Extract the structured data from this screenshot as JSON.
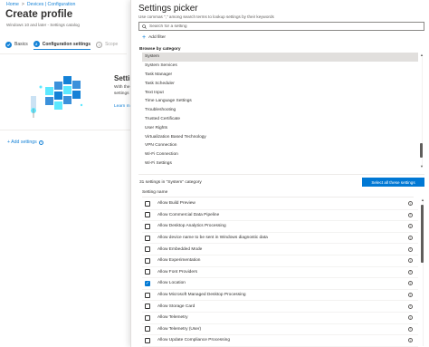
{
  "breadcrumb": [
    "Home",
    "Devices | Configuration"
  ],
  "page": {
    "title": "Create profile",
    "subtitle": "Windows 10 and later - Settings catalog"
  },
  "steps": [
    {
      "number": "1",
      "label": "Basics"
    },
    {
      "number": "2",
      "label": "Configuration settings"
    },
    {
      "number": "3",
      "label": "Scope"
    }
  ],
  "background": {
    "heading": "Settin",
    "text": "With the settings",
    "link": "Learn m",
    "add_settings": "+ Add settings",
    "info_glyph": "i"
  },
  "panel": {
    "title": "Settings picker",
    "description": "Use commas \",\" among search terms to lookup settings by their keywords",
    "search_placeholder": "Search for a setting",
    "add_filter": "Add filter",
    "add_filter_plus": "+",
    "browse_label": "Browse by category",
    "categories": [
      "System",
      "System Services",
      "Task Manager",
      "Task Scheduler",
      "Text Input",
      "Time Language Settings",
      "Troubleshooting",
      "Trusted Certificate",
      "User Rights",
      "Virtualization Based Technology",
      "VPN Connection",
      "Wi-Fi Connection",
      "Wi-Fi Settings"
    ],
    "selected_category": "System",
    "count_label": "31 settings in \"System\" category",
    "select_all_label": "Select all these settings",
    "column_header": "Setting name",
    "settings": [
      {
        "label": "Allow Build Preview",
        "checked": false
      },
      {
        "label": "Allow Commercial Data Pipeline",
        "checked": false
      },
      {
        "label": "Allow Desktop Analytics Processing",
        "checked": false
      },
      {
        "label": "Allow device name to be sent in Windows diagnostic data",
        "checked": false
      },
      {
        "label": "Allow Embedded Mode",
        "checked": false
      },
      {
        "label": "Allow Experimentation",
        "checked": false
      },
      {
        "label": "Allow Font Providers",
        "checked": false
      },
      {
        "label": "Allow Location",
        "checked": true
      },
      {
        "label": "Allow Microsoft Managed Desktop Processing",
        "checked": false
      },
      {
        "label": "Allow Storage Card",
        "checked": false
      },
      {
        "label": "Allow Telemetry",
        "checked": false
      },
      {
        "label": "Allow Telemetry (User)",
        "checked": false
      },
      {
        "label": "Allow Update Compliance Processing",
        "checked": false
      }
    ]
  },
  "glyphs": {
    "checkmark": "✓",
    "info": "i",
    "scroll_up": "▲",
    "scroll_down": "▼"
  },
  "colors": {
    "accent": "#0078d4",
    "selected_category_bg": "#e1dfdd"
  }
}
